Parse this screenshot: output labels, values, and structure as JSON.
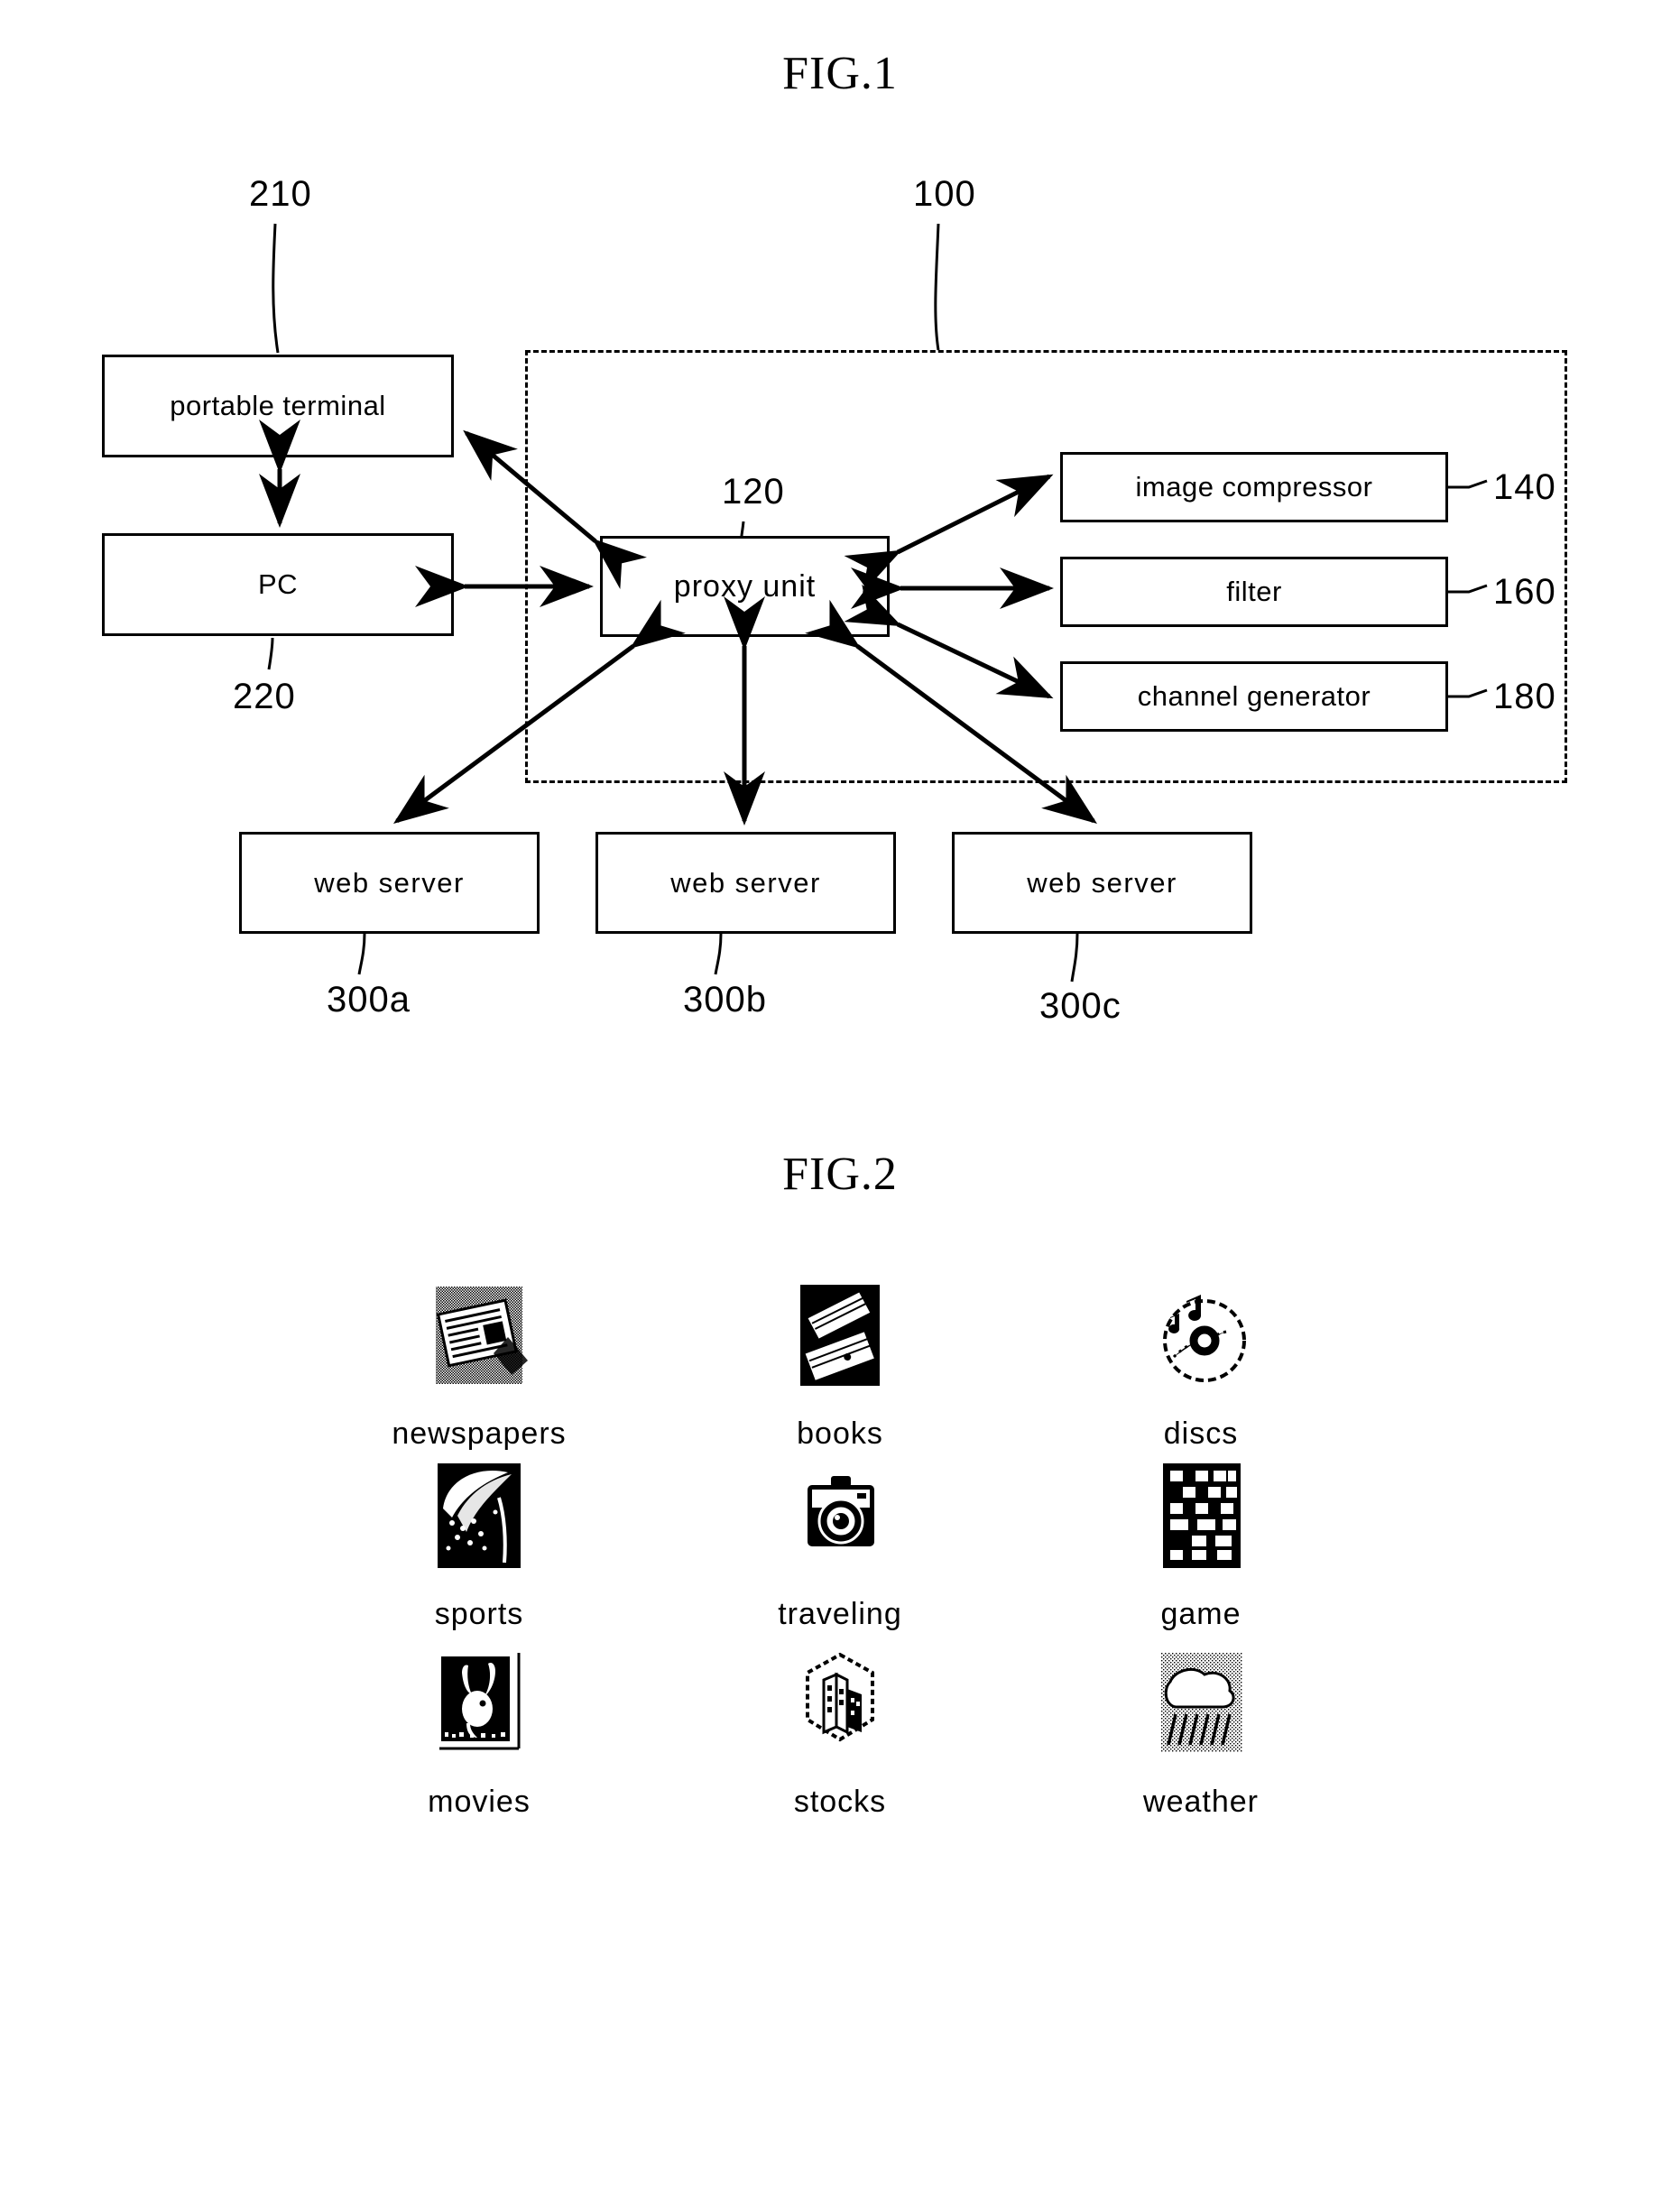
{
  "figures": [
    {
      "id": "fig1",
      "title": "FIG.1"
    },
    {
      "id": "fig2",
      "title": "FIG.2"
    }
  ],
  "fig1": {
    "title": "FIG.1",
    "blocks": {
      "portable_terminal": {
        "label": "portable  terminal",
        "ref": "210"
      },
      "pc": {
        "label": "PC",
        "ref": "220"
      },
      "proxy_unit": {
        "label": "proxy  unit",
        "ref": "120"
      },
      "image_compressor": {
        "label": "image compressor",
        "ref": "140"
      },
      "filter": {
        "label": "filter",
        "ref": "160"
      },
      "channel_generator": {
        "label": "channel  generator",
        "ref": "180"
      },
      "system_boundary": {
        "ref": "100"
      }
    },
    "web_servers": [
      {
        "label": "web  server",
        "ref": "300a"
      },
      {
        "label": "web  server",
        "ref": "300b"
      },
      {
        "label": "web  server",
        "ref": "300c"
      }
    ]
  },
  "fig2": {
    "title": "FIG.2",
    "rows": [
      [
        {
          "label": "newspapers",
          "icon": "newspaper-icon"
        },
        {
          "label": "books",
          "icon": "books-icon"
        },
        {
          "label": "discs",
          "icon": "disc-icon"
        }
      ],
      [
        {
          "label": "sports",
          "icon": "sports-icon"
        },
        {
          "label": "traveling",
          "icon": "camera-icon"
        },
        {
          "label": "game",
          "icon": "checkerboard-icon"
        }
      ],
      [
        {
          "label": "movies",
          "icon": "bunny-icon"
        },
        {
          "label": "stocks",
          "icon": "building-icon"
        },
        {
          "label": "weather",
          "icon": "weather-icon"
        }
      ]
    ]
  },
  "colors": {
    "ink": "#000000",
    "paper": "#ffffff"
  }
}
